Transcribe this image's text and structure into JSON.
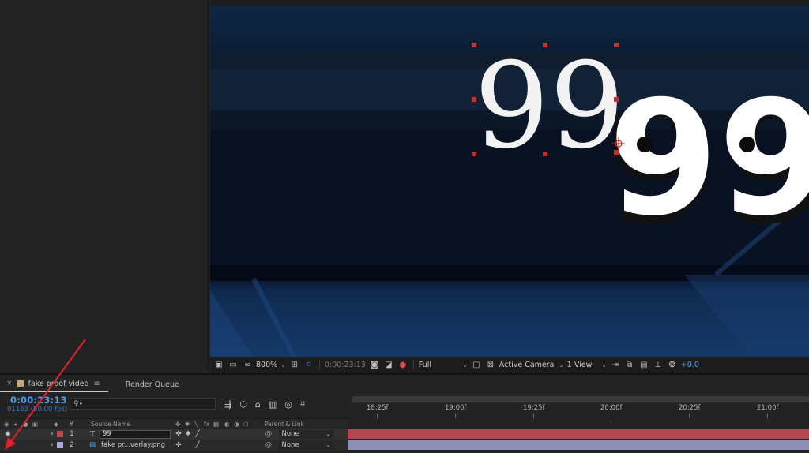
{
  "viewer": {
    "small_number": "99",
    "large_number": "99",
    "toolbar": {
      "zoom": "800%",
      "timecode": "0:00:23:13",
      "resolution": "Full",
      "camera": "Active Camera",
      "views": "1 View",
      "exposure": "+0.0"
    }
  },
  "panel": {
    "tabs": [
      {
        "label": "fake proof video",
        "active": true
      },
      {
        "label": "Render Queue",
        "active": false
      }
    ],
    "timecode": "0:00:23:13",
    "frame_info": "01163 (50.00 fps)",
    "search_placeholder": "⌕"
  },
  "columns": {
    "number": "#",
    "source_name": "Source Name",
    "parent_link": "Parent & Link",
    "fx": "fx"
  },
  "layers": [
    {
      "index": "1",
      "type_icon": "T",
      "name": "99",
      "label_color": "#c0484f",
      "parent": "None",
      "editing": true
    },
    {
      "index": "2",
      "type_icon": "img",
      "name": "fake pr...verlay.png",
      "label_color": "#a9a9d6",
      "parent": "None",
      "editing": false
    }
  ],
  "ruler": {
    "labels": [
      "18:25f",
      "19:00f",
      "19:25f",
      "20:00f",
      "20:25f",
      "21:00f"
    ]
  },
  "colors": {
    "accent_blue": "#4d9cf0",
    "layer1_bar": "#b3464f",
    "layer2_bar": "#8c8fb3",
    "arrow": "#e0202a"
  }
}
